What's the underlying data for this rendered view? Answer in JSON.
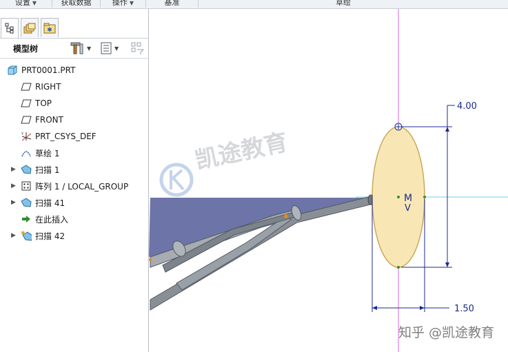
{
  "ribbon": {
    "groups": [
      {
        "label": "设置",
        "has_menu": true
      },
      {
        "label": "获取数据",
        "has_menu": false
      },
      {
        "label": "操作",
        "has_menu": true
      },
      {
        "label": "基准",
        "has_menu": false
      },
      {
        "label": "草绘",
        "has_menu": false
      }
    ]
  },
  "panel": {
    "tabs": [
      {
        "icon": "model-tree-tab-icon",
        "active": true
      },
      {
        "icon": "layers-tab-icon",
        "active": false
      },
      {
        "icon": "favorites-tab-icon",
        "active": false
      }
    ],
    "tree_title": "模型树",
    "tools": [
      "settings-icon",
      "show-icon",
      "filter-icon"
    ]
  },
  "tree": {
    "root": "PRT0001.PRT",
    "items": [
      {
        "label": "RIGHT",
        "icon": "datum-plane-icon",
        "expandable": false
      },
      {
        "label": "TOP",
        "icon": "datum-plane-icon",
        "expandable": false
      },
      {
        "label": "FRONT",
        "icon": "datum-plane-icon",
        "expandable": false
      },
      {
        "label": "PRT_CSYS_DEF",
        "icon": "coordinate-system-icon",
        "expandable": false
      },
      {
        "label": "草绘 1",
        "icon": "sketch-icon",
        "expandable": false
      },
      {
        "label": "扫描 1",
        "icon": "sweep-icon",
        "expandable": true
      },
      {
        "label": "阵列 1 / LOCAL_GROUP",
        "icon": "pattern-icon",
        "expandable": true
      },
      {
        "label": "扫描 41",
        "icon": "sweep-icon",
        "expandable": true
      },
      {
        "label": "在此插入",
        "icon": "insert-here-icon",
        "expandable": false
      },
      {
        "label": "扫描 42",
        "icon": "sweep-new-icon",
        "expandable": true
      }
    ]
  },
  "viewport": {
    "dimension_vertical": "4.00",
    "dimension_horizontal": "1.50",
    "sketch_marker_m": "M",
    "sketch_marker_v": "V",
    "watermark_brand": "凯途教育",
    "watermark_caption": "知乎 @凯途教育"
  },
  "colors": {
    "sketch_fill": "#f8e7b4",
    "sketch_stroke": "#c9a95a",
    "dimension": "#1b2a8c",
    "centerline_magenta": "#d86ad8",
    "centerline_cyan": "#6fd0d8",
    "model_surface": "#6d74a8"
  }
}
